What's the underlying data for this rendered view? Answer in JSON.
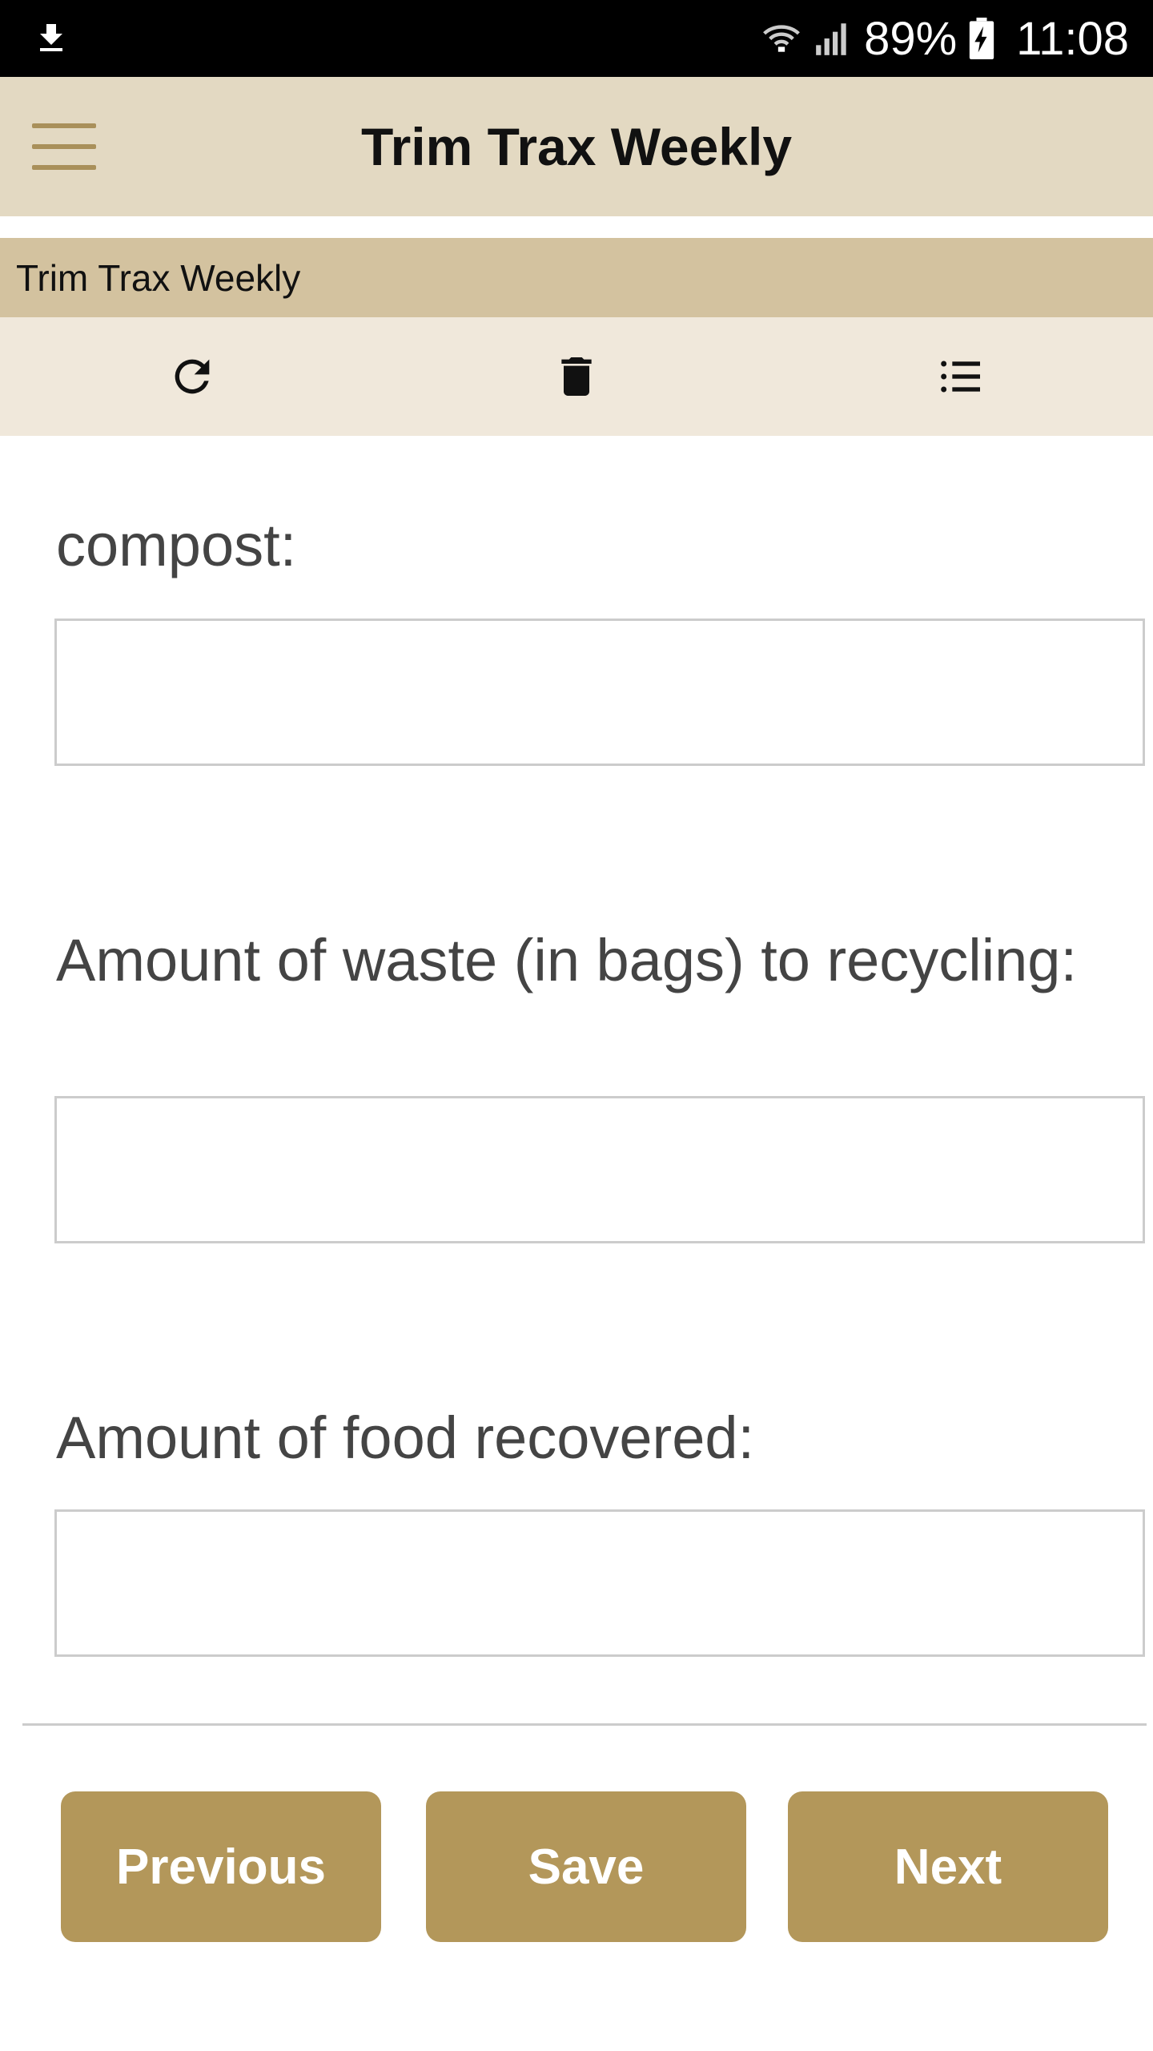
{
  "status_bar": {
    "battery_percent": "89%",
    "time": "11:08",
    "icons": [
      "download-icon",
      "wifi-icon",
      "signal-icon",
      "battery-charging-icon"
    ]
  },
  "app_bar": {
    "title": "Trim Trax Weekly",
    "menu_icon": "hamburger-menu-icon"
  },
  "section": {
    "title": "Trim Trax Weekly"
  },
  "toolbar": {
    "icons": [
      "refresh-icon",
      "trash-icon",
      "list-icon"
    ]
  },
  "form": {
    "fields": [
      {
        "label": "compost:",
        "value": ""
      },
      {
        "label": "Amount of waste (in bags) to recycling:",
        "value": ""
      },
      {
        "label": "Amount of food recovered:",
        "value": ""
      }
    ]
  },
  "buttons": {
    "previous": "Previous",
    "save": "Save",
    "next": "Next"
  },
  "colors": {
    "app_bar_bg": "#e3d9c2",
    "section_bg": "#d3c29f",
    "toolbar_bg": "#f0e8db",
    "button_bg": "#b3975a",
    "menu_icon": "#a9905a"
  }
}
